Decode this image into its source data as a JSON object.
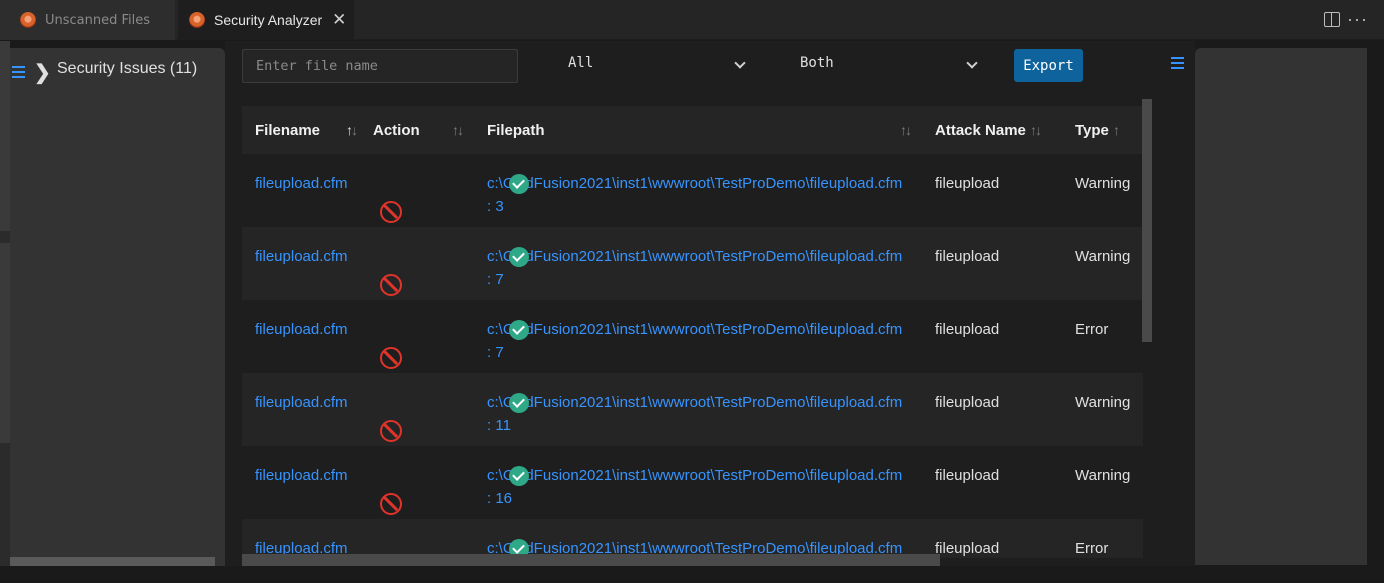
{
  "tabs": [
    {
      "label": "Unscanned Files",
      "active": false
    },
    {
      "label": "Security Analyzer",
      "active": true,
      "close": "✕"
    }
  ],
  "editor_actions": {
    "split_icon": "split-editor-icon",
    "more": "···"
  },
  "sidebar": {
    "title": "Security Issues (11)",
    "chevron": "❯"
  },
  "toolbar": {
    "search_placeholder": "Enter file name",
    "search_value": "",
    "filter_value": "All",
    "type_value": "Both",
    "export_label": "Export"
  },
  "table": {
    "columns": [
      "Filename",
      "Action",
      "Filepath",
      "Attack Name",
      "Type"
    ],
    "rows": [
      {
        "filename": "fileupload.cfm",
        "filepath": "c:\\ColdFusion2021\\inst1\\wwwroot\\TestProDemo\\fileupload.cfm",
        "line": ": 3",
        "attack": "fileupload",
        "type": "Warning"
      },
      {
        "filename": "fileupload.cfm",
        "filepath": "c:\\ColdFusion2021\\inst1\\wwwroot\\TestProDemo\\fileupload.cfm",
        "line": ": 7",
        "attack": "fileupload",
        "type": "Warning"
      },
      {
        "filename": "fileupload.cfm",
        "filepath": "c:\\ColdFusion2021\\inst1\\wwwroot\\TestProDemo\\fileupload.cfm",
        "line": ": 7",
        "attack": "fileupload",
        "type": "Error"
      },
      {
        "filename": "fileupload.cfm",
        "filepath": "c:\\ColdFusion2021\\inst1\\wwwroot\\TestProDemo\\fileupload.cfm",
        "line": ": 11",
        "attack": "fileupload",
        "type": "Warning"
      },
      {
        "filename": "fileupload.cfm",
        "filepath": "c:\\ColdFusion2021\\inst1\\wwwroot\\TestProDemo\\fileupload.cfm",
        "line": ": 16",
        "attack": "fileupload",
        "type": "Warning"
      },
      {
        "filename": "fileupload.cfm",
        "filepath": "c:\\ColdFusion2021\\inst1\\wwwroot\\TestProDemo\\fileupload.cfm",
        "line": "",
        "attack": "fileupload",
        "type": "Error"
      }
    ]
  },
  "colors": {
    "accent": "#3794ff",
    "button": "#0e639c",
    "ok": "#2ea886",
    "block": "#e0342a"
  }
}
